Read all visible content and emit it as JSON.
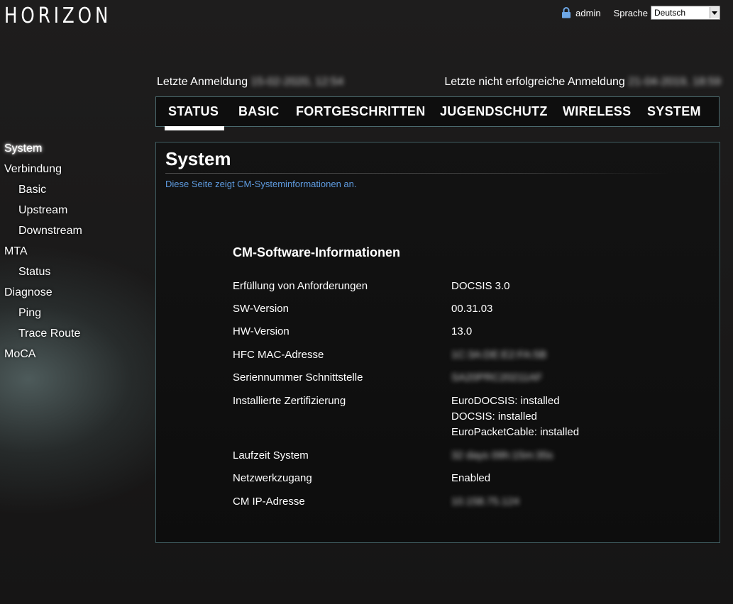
{
  "header": {
    "logo": "HORIZON",
    "user": "admin",
    "language_label": "Sprache",
    "language_value": "Deutsch"
  },
  "login": {
    "last_login_label": "Letzte Anmeldung",
    "last_login_value": "15-02-2020, 12:54",
    "last_failed_label": "Letzte nicht erfolgreiche Anmeldung",
    "last_failed_value": "21-04-2019, 18:59"
  },
  "tabs": [
    {
      "label": "STATUS",
      "active": true
    },
    {
      "label": "BASIC"
    },
    {
      "label": "FORTGESCHRITTEN"
    },
    {
      "label": "JUGENDSCHUTZ"
    },
    {
      "label": "WIRELESS"
    },
    {
      "label": "SYSTEM"
    }
  ],
  "sidebar": [
    {
      "label": "System",
      "active": true
    },
    {
      "label": "Verbindung"
    },
    {
      "label": "Basic"
    },
    {
      "label": "Upstream"
    },
    {
      "label": "Downstream"
    },
    {
      "label": "MTA"
    },
    {
      "label": "Status"
    },
    {
      "label": "Diagnose"
    },
    {
      "label": "Ping"
    },
    {
      "label": "Trace Route"
    },
    {
      "label": "MoCA"
    }
  ],
  "panel": {
    "title": "System",
    "description": "Diese Seite zeigt CM-Systeminformationen an.",
    "section_title": "CM-Software-Informationen",
    "rows": [
      {
        "label": "Erfüllung von Anforderungen",
        "values": [
          "DOCSIS 3.0"
        ]
      },
      {
        "label": "SW-Version",
        "values": [
          "00.31.03"
        ]
      },
      {
        "label": "HW-Version",
        "values": [
          "13.0"
        ]
      },
      {
        "label": "HFC MAC-Adresse",
        "values": [
          "1C:3A:DE:E2:FA:5B"
        ],
        "blurred": true
      },
      {
        "label": "Seriennummer Schnittstelle",
        "values": [
          "SA20PRC20211AF"
        ],
        "blurred": true
      },
      {
        "label": "Installierte Zertifizierung",
        "values": [
          "EuroDOCSIS: installed",
          "DOCSIS: installed",
          "EuroPacketCable: installed"
        ]
      },
      {
        "label": "Laufzeit System",
        "values": [
          "32 days 09h:15m:35s"
        ],
        "blurred": true
      },
      {
        "label": "Netzwerkzugang",
        "values": [
          "Enabled"
        ]
      },
      {
        "label": "CM IP-Adresse",
        "values": [
          "10.158.75.124"
        ],
        "blurred": true
      }
    ]
  },
  "colors": {
    "accent_link": "#5e9be0",
    "border": "#3f5c60",
    "background": "#1b1a1a"
  }
}
